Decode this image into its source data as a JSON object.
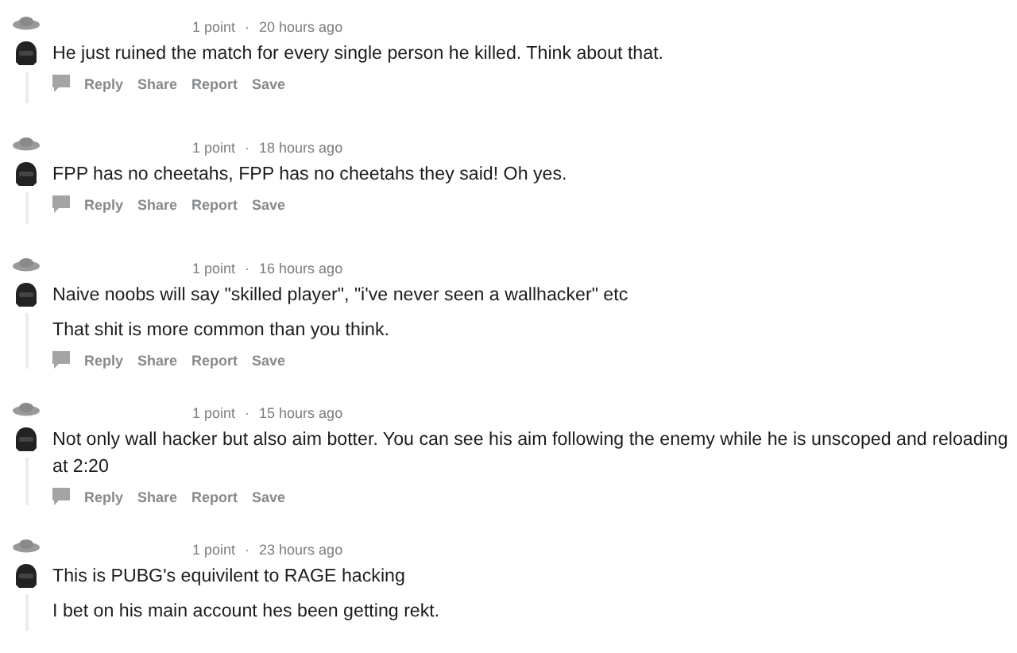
{
  "comments": [
    {
      "points": "1 point",
      "separator": "·",
      "time": "20 hours ago",
      "paragraphs": [
        "He just ruined the match for every single person he killed. Think about that."
      ],
      "actions": [
        "Reply",
        "Share",
        "Report",
        "Save"
      ]
    },
    {
      "points": "1 point",
      "separator": "·",
      "time": "18 hours ago",
      "paragraphs": [
        "FPP has no cheetahs, FPP has no cheetahs they said! Oh yes."
      ],
      "actions": [
        "Reply",
        "Share",
        "Report",
        "Save"
      ]
    },
    {
      "points": "1 point",
      "separator": "·",
      "time": "16 hours ago",
      "paragraphs": [
        "Naive noobs will say \"skilled player\", \"i've never seen a wallhacker\" etc",
        "That shit is more common than you think."
      ],
      "actions": [
        "Reply",
        "Share",
        "Report",
        "Save"
      ]
    },
    {
      "points": "1 point",
      "separator": "·",
      "time": "15 hours ago",
      "paragraphs": [
        "Not only wall hacker but also aim botter. You can see his aim following the enemy while he is unscoped and reloading at 2:20"
      ],
      "actions": [
        "Reply",
        "Share",
        "Report",
        "Save"
      ]
    },
    {
      "points": "1 point",
      "separator": "·",
      "time": "23 hours ago",
      "paragraphs": [
        "This is PUBG's equivilent to RAGE hacking",
        "I bet on his main account hes been getting rekt."
      ]
    }
  ]
}
